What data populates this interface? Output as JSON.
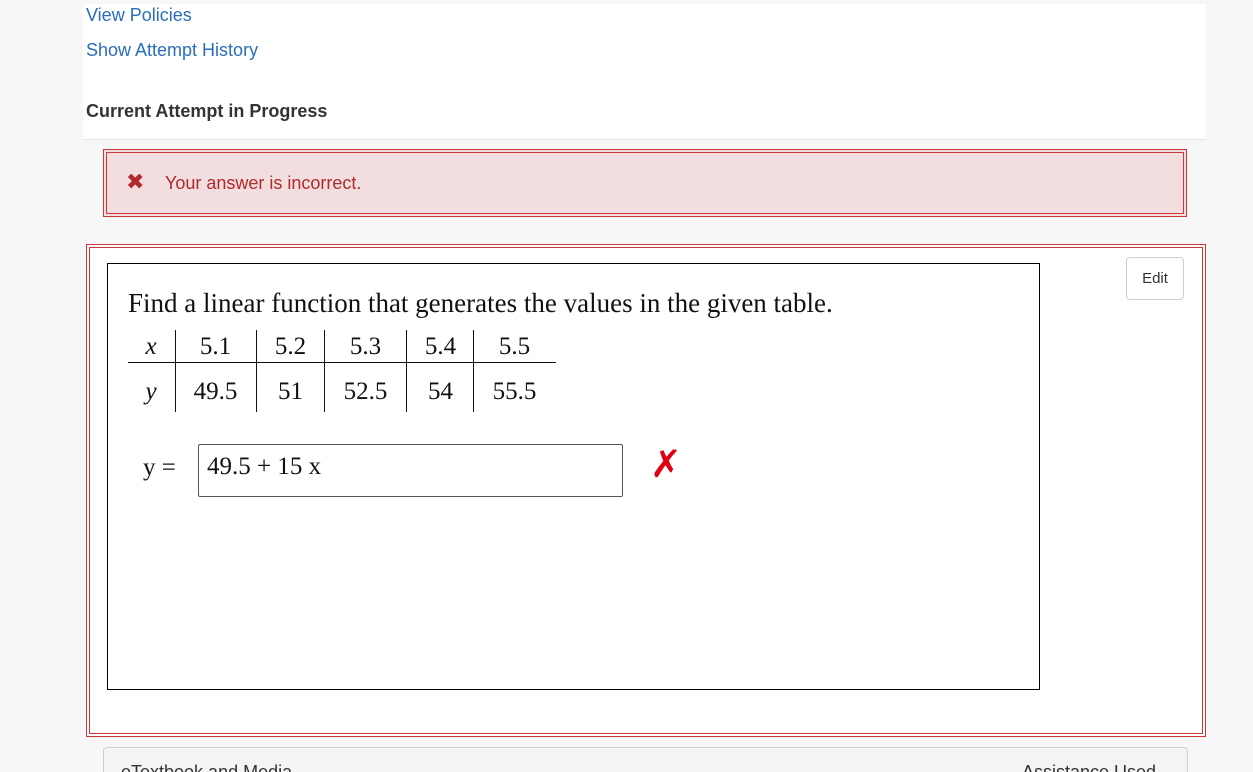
{
  "links": {
    "view_policies": "View Policies",
    "show_attempt_history": "Show Attempt History"
  },
  "attempt": {
    "title": "Current Attempt in Progress"
  },
  "alert": {
    "icon": "close-icon",
    "icon_glyph": "✖",
    "message": "Your answer is incorrect."
  },
  "question": {
    "edit_label": "Edit",
    "prompt": "Find a linear function that generates the values in the given table.",
    "table": {
      "row_labels": [
        "x",
        "y"
      ],
      "x_values": [
        "5.1",
        "5.2",
        "5.3",
        "5.4",
        "5.5"
      ],
      "y_values": [
        "49.5",
        "51",
        "52.5",
        "54",
        "55.5"
      ]
    },
    "answer_label": "y =",
    "answer_value": "49.5 + 15 x",
    "result_glyph": "✗"
  },
  "bottom": {
    "left_label": "eTextbook and Media",
    "right_label": "Assistance Used"
  },
  "colors": {
    "link": "#2a6ebb",
    "error": "#b0292c",
    "error_bg": "#f3dedf",
    "wrong_mark": "#e0000f"
  }
}
